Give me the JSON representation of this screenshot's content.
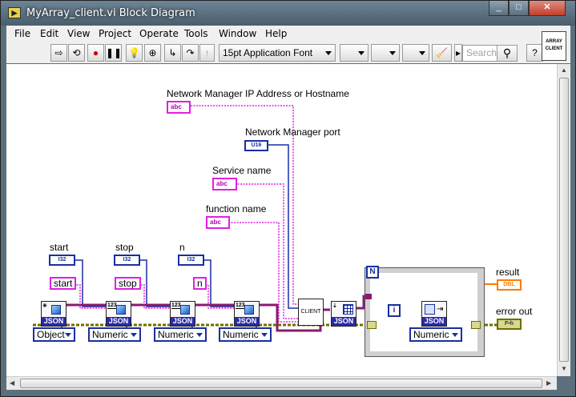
{
  "window": {
    "title": "MyArray_client.vi Block Diagram",
    "min": "_",
    "max": "□",
    "close": "✕"
  },
  "menu": [
    "File",
    "Edit",
    "View",
    "Project",
    "Operate",
    "Tools",
    "Window",
    "Help"
  ],
  "toolbar": {
    "font_label": "15pt Application Font",
    "search_placeholder": "Search",
    "connector_pane": [
      "ARRAY",
      "CLIENT"
    ]
  },
  "diagram": {
    "labels": {
      "ip": "Network Manager IP Address or Hostname",
      "port": "Network Manager port",
      "service": "Service name",
      "function": "function name",
      "start": "start",
      "stop": "stop",
      "n": "n",
      "result": "result",
      "error_out": "error out"
    },
    "terminals": {
      "abc": "abc",
      "u16": "U16",
      "i32": "I32",
      "dbl": "DBL",
      "err": "F•h"
    },
    "constants": {
      "start": "start",
      "stop": "stop",
      "n": "n"
    },
    "rings": {
      "object": "Object",
      "numeric": "Numeric"
    },
    "vi_text": {
      "json": "JSON",
      "client": "CLIENT",
      "n": "N",
      "i": "i",
      "num": "123"
    }
  }
}
